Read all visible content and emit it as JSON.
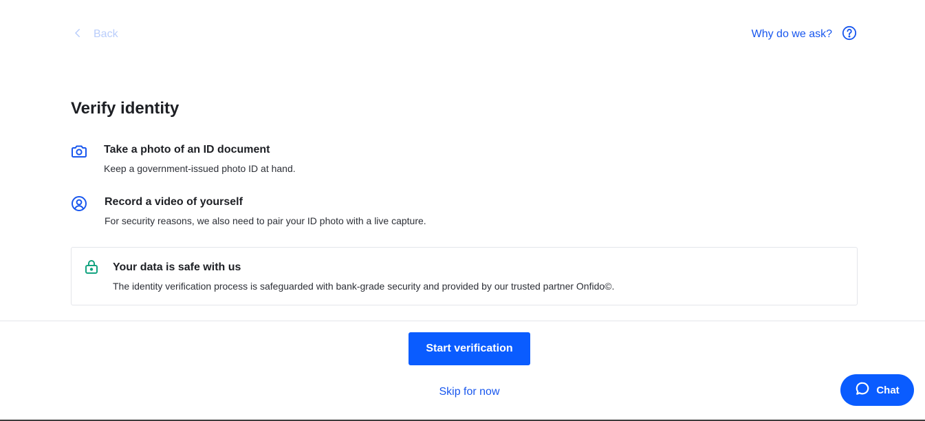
{
  "nav": {
    "back_label": "Back",
    "back_icon": "chevron-left-icon",
    "help_label": "Why do we ask?",
    "help_icon": "question-circle-icon"
  },
  "page": {
    "title": "Verify identity"
  },
  "steps": [
    {
      "icon": "camera-icon",
      "title": "Take a photo of an ID document",
      "description": "Keep a government-issued photo ID at hand."
    },
    {
      "icon": "user-circle-icon",
      "title": "Record a video of yourself",
      "description": "For security reasons, we also need to pair your ID photo with a live capture."
    }
  ],
  "security": {
    "icon": "lock-icon",
    "title": "Your data is safe with us",
    "description": "The identity verification process is safeguarded with bank-grade security and provided by our trusted partner Onfido©."
  },
  "actions": {
    "primary_label": "Start verification",
    "skip_label": "Skip for now"
  },
  "chat": {
    "label": "Chat",
    "icon": "chat-bubble-icon"
  },
  "colors": {
    "accent": "#0a5cff",
    "link": "#1756ee",
    "back_disabled": "#b9cdfb",
    "safe_icon": "#12a37f",
    "text": "#1d1f24"
  }
}
